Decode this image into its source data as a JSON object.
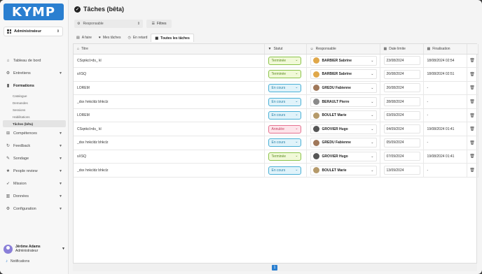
{
  "app": {
    "logo_text": "KYMP"
  },
  "sidebar": {
    "role_label": "Administrateur",
    "items": [
      {
        "label": "Tableau de bord",
        "icon": "home-icon"
      },
      {
        "label": "Entretiens",
        "icon": "gear-icon"
      },
      {
        "label": "Formations",
        "icon": "book-icon"
      },
      {
        "label": "Compétences",
        "icon": "chart-icon"
      },
      {
        "label": "Feedback",
        "icon": "refresh-icon"
      },
      {
        "label": "Sondage",
        "icon": "pen-icon"
      },
      {
        "label": "People review",
        "icon": "star-icon"
      },
      {
        "label": "Mission",
        "icon": "rocket-icon"
      },
      {
        "label": "Données",
        "icon": "bar-chart-icon"
      },
      {
        "label": "Configuration",
        "icon": "gear-icon"
      }
    ],
    "sub_items": [
      "Catalogue",
      "Demandes",
      "Sessions",
      "Habilitations",
      "Tâches (bêta)"
    ],
    "user_name": "Jérôme Adams",
    "user_role": "Administrateur",
    "notifications_label": "Notifications"
  },
  "page": {
    "title": "Tâches (bêta)",
    "responsable_placeholder": "Responsable",
    "filters_label": "Filtres",
    "tabs": [
      "A faire",
      "Mes tâches",
      "En retard",
      "Toutes les tâches"
    ]
  },
  "table": {
    "headers": [
      "Titre",
      "Statut",
      "Responsable",
      "Date limite",
      "Finalisation"
    ],
    "rows": [
      {
        "title": "CSqnkcl>ds_ kl",
        "status": "Terminée",
        "status_type": "done",
        "owner": "BARBIER Sabrine",
        "due": "23/08/2024",
        "final": "18/08/2024 02:54"
      },
      {
        "title": "sXSQ",
        "status": "Terminée",
        "status_type": "done",
        "owner": "BARBIER Sabrine",
        "due": "26/08/2024",
        "final": "18/08/2024 02:51"
      },
      {
        "title": "LOREM",
        "status": "En cours",
        "status_type": "prog",
        "owner": "GREDU Fabienne",
        "due": "26/08/2024",
        "final": "-"
      },
      {
        "title": "_dsx hnkcldz bhkclz",
        "status": "En cours",
        "status_type": "prog",
        "owner": "BERAULT Pierre",
        "due": "28/08/2024",
        "final": "-"
      },
      {
        "title": "LOREM",
        "status": "En cours",
        "status_type": "prog",
        "owner": "BOULET Marie",
        "due": "03/09/2024",
        "final": "-"
      },
      {
        "title": "CSqnkcl>ds_ kl",
        "status": "Annulée",
        "status_type": "canc",
        "owner": "GROVIER Hugo",
        "due": "04/09/2024",
        "final": "19/08/2024 01:41"
      },
      {
        "title": "_dsx hnkcldz bhkclz",
        "status": "En cours",
        "status_type": "prog",
        "owner": "GREDU Fabienne",
        "due": "05/09/2024",
        "final": "-"
      },
      {
        "title": "sXSQ",
        "status": "Terminée",
        "status_type": "done",
        "owner": "GROVIER Hugo",
        "due": "07/09/2024",
        "final": "19/08/2024 01:41"
      },
      {
        "title": "_dsx hnkcldz bhkclz",
        "status": "En cours",
        "status_type": "prog",
        "owner": "BOULET Marie",
        "due": "13/09/2024",
        "final": "-"
      }
    ]
  },
  "pagination": {
    "current_page": "1"
  },
  "colors": {
    "accent": "#2a7fd0",
    "done": "#8bc34a",
    "progress": "#4ab0d6",
    "cancelled": "#e57391"
  }
}
